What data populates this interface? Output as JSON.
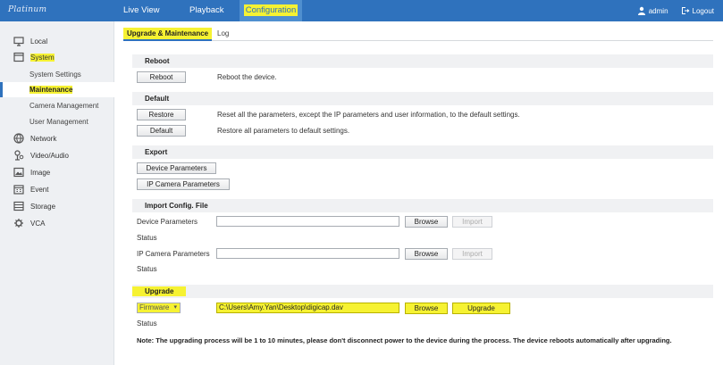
{
  "brand": "Platinum",
  "nav": {
    "live_view": "Live View",
    "playback": "Playback",
    "configuration": "Configuration"
  },
  "user": {
    "name": "admin",
    "logout": "Logout"
  },
  "sidebar": {
    "local": "Local",
    "system": "System",
    "system_settings": "System Settings",
    "maintenance": "Maintenance",
    "camera_management": "Camera Management",
    "user_management": "User Management",
    "network": "Network",
    "video_audio": "Video/Audio",
    "image": "Image",
    "event": "Event",
    "storage": "Storage",
    "vca": "VCA"
  },
  "tabs": {
    "upgrade_maintenance": "Upgrade & Maintenance",
    "log": "Log"
  },
  "reboot": {
    "title": "Reboot",
    "button": "Reboot",
    "desc": "Reboot the device."
  },
  "default": {
    "title": "Default",
    "restore_button": "Restore",
    "restore_desc": "Reset all the parameters, except the IP parameters and user information, to the default settings.",
    "default_button": "Default",
    "default_desc": "Restore all parameters to default settings."
  },
  "export": {
    "title": "Export",
    "device_params": "Device Parameters",
    "ip_camera_params": "IP Camera Parameters"
  },
  "import": {
    "title": "Import Config. File",
    "device_label": "Device Parameters",
    "ipcam_label": "IP Camera Parameters",
    "status": "Status",
    "browse": "Browse",
    "import": "Import"
  },
  "upgrade": {
    "title": "Upgrade",
    "type": "Firmware",
    "path": "C:\\Users\\Amy.Yan\\Desktop\\digicap.dav",
    "browse": "Browse",
    "upgrade_button": "Upgrade",
    "status": "Status"
  },
  "note": "Note: The upgrading process will be 1 to 10 minutes, please don't disconnect power to the device during the process. The device reboots automatically after upgrading."
}
